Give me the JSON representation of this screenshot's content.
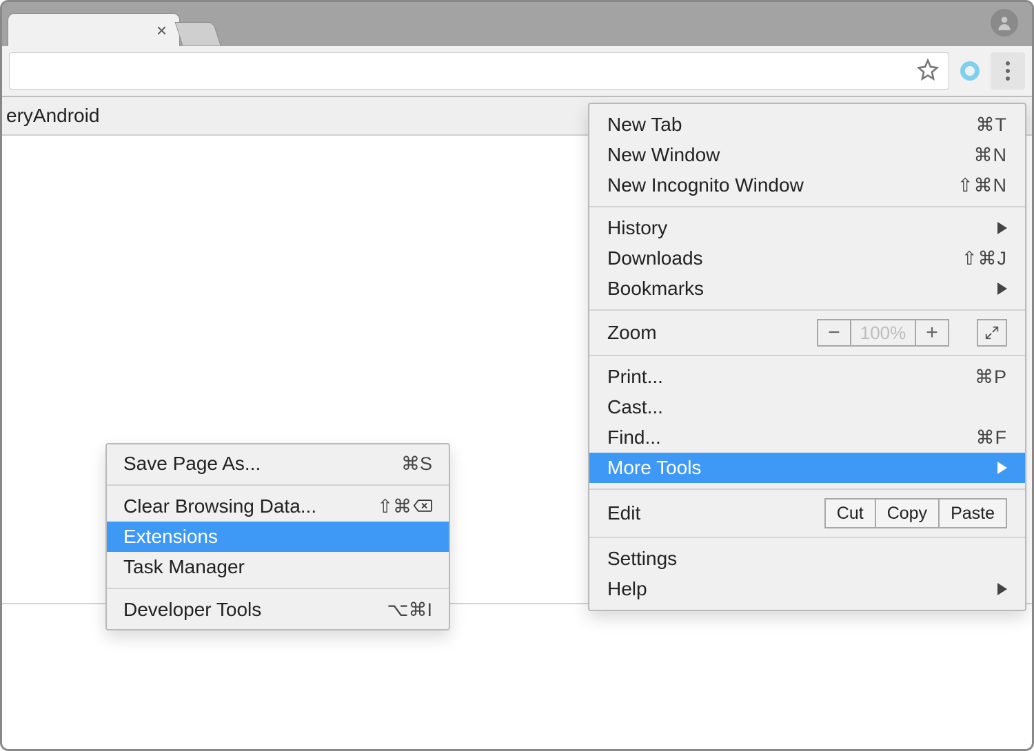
{
  "page": {
    "partial_title": "eryAndroid"
  },
  "menu": {
    "new_tab": {
      "label": "New Tab",
      "shortcut": "⌘T"
    },
    "new_window": {
      "label": "New Window",
      "shortcut": "⌘N"
    },
    "new_incognito": {
      "label": "New Incognito Window",
      "shortcut": "⇧⌘N"
    },
    "history": {
      "label": "History"
    },
    "downloads": {
      "label": "Downloads",
      "shortcut": "⇧⌘J"
    },
    "bookmarks": {
      "label": "Bookmarks"
    },
    "zoom": {
      "label": "Zoom",
      "value": "100%",
      "minus": "−",
      "plus": "+"
    },
    "print": {
      "label": "Print...",
      "shortcut": "⌘P"
    },
    "cast": {
      "label": "Cast..."
    },
    "find": {
      "label": "Find...",
      "shortcut": "⌘F"
    },
    "more_tools": {
      "label": "More Tools"
    },
    "edit": {
      "label": "Edit",
      "cut": "Cut",
      "copy": "Copy",
      "paste": "Paste"
    },
    "settings": {
      "label": "Settings"
    },
    "help": {
      "label": "Help"
    }
  },
  "submenu": {
    "save_page": {
      "label": "Save Page As...",
      "shortcut": "⌘S"
    },
    "clear_browsing": {
      "label": "Clear Browsing Data...",
      "shortcut_prefix": "⇧⌘"
    },
    "extensions": {
      "label": "Extensions"
    },
    "task_manager": {
      "label": "Task Manager"
    },
    "developer_tools": {
      "label": "Developer Tools",
      "shortcut": "⌥⌘I"
    }
  }
}
